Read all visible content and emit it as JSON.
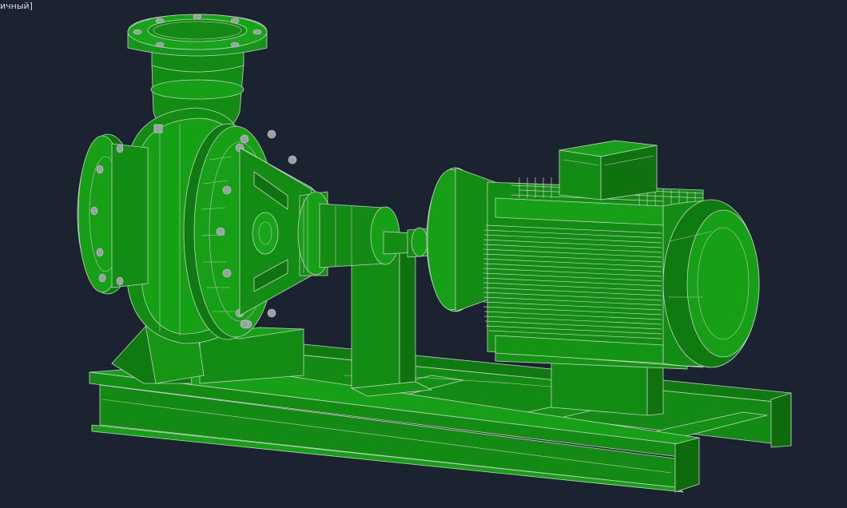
{
  "viewport": {
    "visual_style_label": "ичный]",
    "background_color": "#1b2331"
  },
  "model": {
    "fill_color": "#138a13",
    "fill_dark": "#0e6e0e",
    "fill_light": "#19a019",
    "edge_color": "#c8d0c8",
    "bolt_color": "#9aa0a6"
  }
}
